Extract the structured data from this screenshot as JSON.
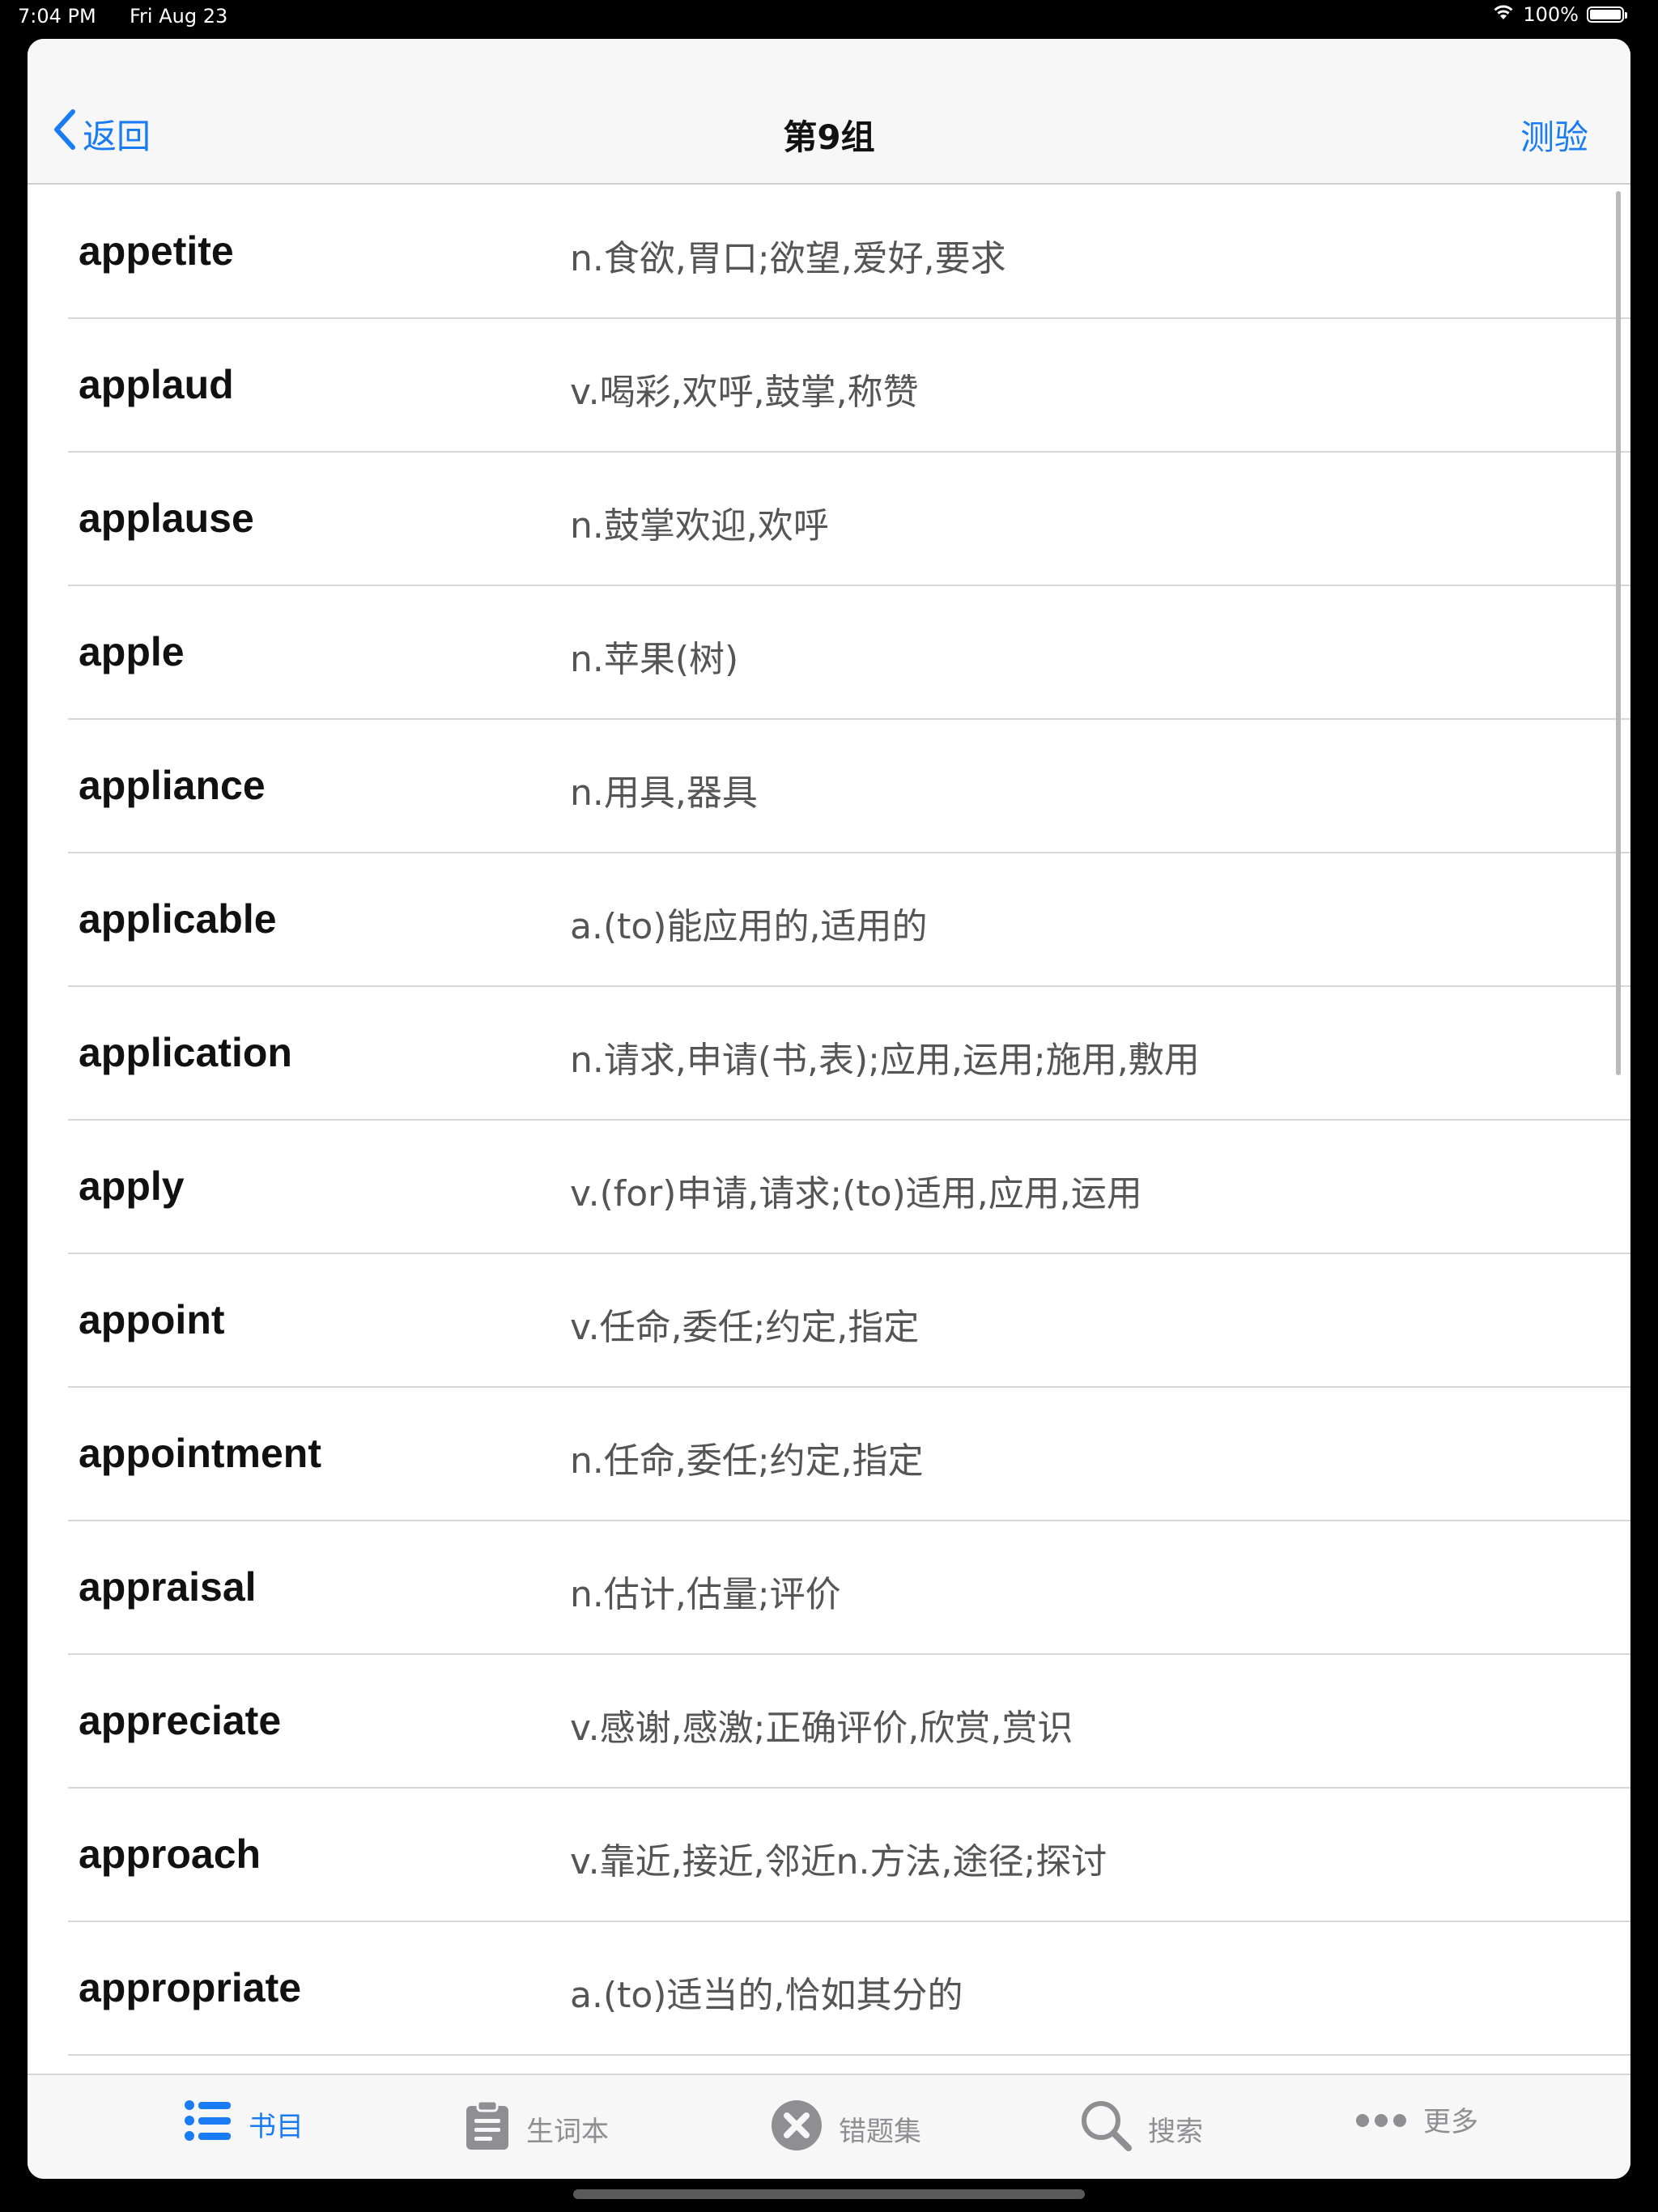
{
  "status_bar": {
    "time": "7:04 PM",
    "date": "Fri Aug 23",
    "battery": "100%",
    "wifi_icon": "wifi-icon",
    "battery_icon": "battery-icon"
  },
  "nav": {
    "back_label": "返回",
    "title": "第9组",
    "quiz_label": "测验"
  },
  "words": [
    {
      "word": "appetite",
      "meaning": "n.食欲,胃口;欲望,爱好,要求"
    },
    {
      "word": "applaud",
      "meaning": "v.喝彩,欢呼,鼓掌,称赞"
    },
    {
      "word": "applause",
      "meaning": "n.鼓掌欢迎,欢呼"
    },
    {
      "word": "apple",
      "meaning": "n.苹果(树)"
    },
    {
      "word": "appliance",
      "meaning": "n.用具,器具"
    },
    {
      "word": "applicable",
      "meaning": "a.(to)能应用的,适用的"
    },
    {
      "word": "application",
      "meaning": "n.请求,申请(书,表);应用,运用;施用,敷用"
    },
    {
      "word": "apply",
      "meaning": "v.(for)申请,请求;(to)适用,应用,运用"
    },
    {
      "word": "appoint",
      "meaning": "v.任命,委任;约定,指定"
    },
    {
      "word": "appointment",
      "meaning": "n.任命,委任;约定,指定"
    },
    {
      "word": "appraisal",
      "meaning": "n.估计,估量;评价"
    },
    {
      "word": "appreciate",
      "meaning": "v.感谢,感激;正确评价,欣赏,赏识"
    },
    {
      "word": "approach",
      "meaning": "v.靠近,接近,邻近n.方法,途径;探讨"
    },
    {
      "word": "appropriate",
      "meaning": "a.(to)适当的,恰如其分的"
    }
  ],
  "tabs": [
    {
      "label": "书目",
      "icon": "list-icon",
      "active": true
    },
    {
      "label": "生词本",
      "icon": "clipboard-icon",
      "active": false
    },
    {
      "label": "错题集",
      "icon": "x-circle-icon",
      "active": false
    },
    {
      "label": "搜索",
      "icon": "search-icon",
      "active": false
    },
    {
      "label": "更多",
      "icon": "more-icon",
      "active": false
    }
  ],
  "colors": {
    "accent": "#1a7cf5",
    "inactive": "#8e8e93",
    "meaning_text": "#555555"
  }
}
